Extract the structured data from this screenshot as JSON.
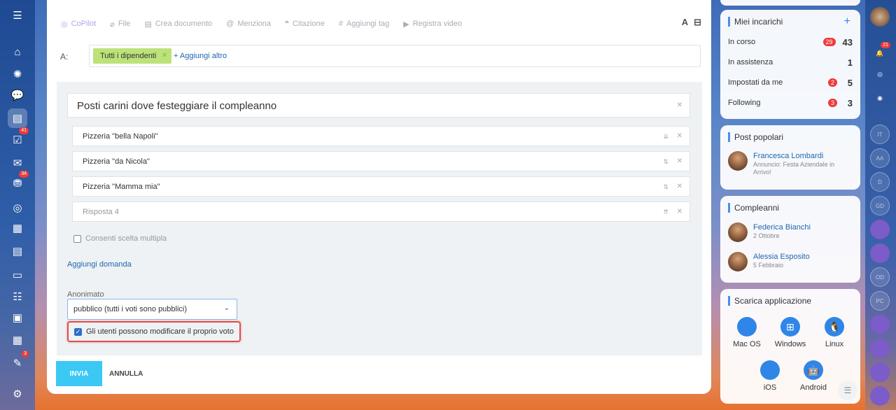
{
  "left_sidebar": [
    {
      "icon": "menu-icon",
      "glyph": "☰"
    },
    {
      "icon": "home-icon",
      "glyph": "⌂"
    },
    {
      "icon": "copilot-icon",
      "glyph": "✺"
    },
    {
      "icon": "chat-icon",
      "glyph": "💬"
    },
    {
      "icon": "feed-icon",
      "glyph": "▤",
      "active": true
    },
    {
      "icon": "tasks-icon",
      "glyph": "☑",
      "badge": "41"
    },
    {
      "icon": "mail-icon",
      "glyph": "✉"
    },
    {
      "icon": "crm-icon",
      "glyph": "⛃",
      "badge": "34"
    },
    {
      "icon": "target-icon",
      "glyph": "◎"
    },
    {
      "icon": "calendar-icon",
      "glyph": "▦"
    },
    {
      "icon": "docs-icon",
      "glyph": "▤"
    },
    {
      "icon": "drive-icon",
      "glyph": "▭"
    },
    {
      "icon": "team-icon",
      "glyph": "☷"
    },
    {
      "icon": "board-icon",
      "glyph": "▣"
    },
    {
      "icon": "schedule-icon",
      "glyph": "▦"
    },
    {
      "icon": "approvals-icon",
      "glyph": "✎",
      "badge": "3"
    },
    {
      "icon": "settings-icon",
      "glyph": "⚙"
    }
  ],
  "toolbar": {
    "copilot": "CoPilot",
    "file": "File",
    "create_doc": "Crea documento",
    "mention": "Menziona",
    "quote": "Citazione",
    "tag": "Aggiungi tag",
    "video": "Registra video",
    "format": "A"
  },
  "recipients": {
    "label": "A:",
    "chip": "Tutti i dipendenti",
    "add_more": "+ Aggiungi altro"
  },
  "poll": {
    "question": "Posti carini dove festeggiare il compleanno",
    "answers": [
      {
        "text": "Pizzeria \"bella Napoli\"",
        "placeholder": false,
        "sort": "⇊"
      },
      {
        "text": "Pizzeria \"da Nicola\"",
        "placeholder": false,
        "sort": "⇅"
      },
      {
        "text": "Pizzeria \"Mamma mia\"",
        "placeholder": false,
        "sort": "⇅"
      },
      {
        "text": "Risposta  4",
        "placeholder": true,
        "sort": "⇈"
      }
    ],
    "multiple_choice": "Consenti scelta multipla",
    "add_question": "Aggiungi domanda",
    "anonymity_label": "Anonimato",
    "anonymity_value": "pubblico (tutti i voti sono pubblici)",
    "allow_edit": "Gli utenti possono modificare il proprio voto"
  },
  "actions": {
    "send": "INVIA",
    "cancel": "ANNULLA"
  },
  "tasks": {
    "title": "Miei incarichi",
    "rows": [
      {
        "label": "In corso",
        "badge": "29",
        "count": "43"
      },
      {
        "label": "In assistenza",
        "badge": "",
        "count": "1"
      },
      {
        "label": "Impostati da me",
        "badge": "2",
        "count": "5"
      },
      {
        "label": "Following",
        "badge": "3",
        "count": "3"
      }
    ]
  },
  "popular": {
    "title": "Post popolari",
    "name": "Francesca Lombardi",
    "sub": "Annuncio: Festa Aziendale in Arrivo!"
  },
  "birthdays": {
    "title": "Compleanni",
    "people": [
      {
        "name": "Federica Bianchi",
        "date": "2 Ottobre"
      },
      {
        "name": "Alessia Esposito",
        "date": "5 Febbraio"
      }
    ]
  },
  "download": {
    "title": "Scarica applicazione",
    "apps": [
      {
        "label": "Mac OS",
        "icon": "apple-icon",
        "glyph": ""
      },
      {
        "label": "Windows",
        "icon": "windows-icon",
        "glyph": "⊞"
      },
      {
        "label": "Linux",
        "icon": "linux-icon",
        "glyph": "🐧"
      },
      {
        "label": "iOS",
        "icon": "ios-icon",
        "glyph": ""
      },
      {
        "label": "Android",
        "icon": "android-icon",
        "glyph": "🤖"
      }
    ]
  },
  "right_sidebar": {
    "notification_badge": "21",
    "avatars": [
      "IT",
      "AA",
      "D",
      "GD",
      "",
      "",
      "OD",
      "PC",
      "",
      "",
      "",
      ""
    ]
  },
  "colors": {
    "accent": "#2067b0",
    "send": "#3bc8f5",
    "chip": "#bce279",
    "badge": "#ee3b3b",
    "highlight": "#e04b4b"
  }
}
